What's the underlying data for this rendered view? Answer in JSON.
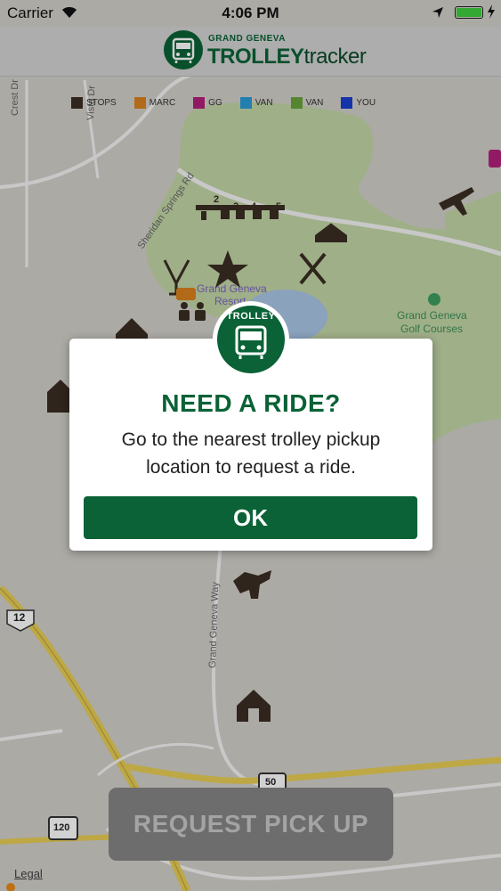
{
  "status_bar": {
    "carrier": "Carrier",
    "time": "4:06 PM"
  },
  "header": {
    "brand_top": "GRAND GENEVA",
    "brand_main_bold": "TROLLEY",
    "brand_main_light": "tracker"
  },
  "legend": [
    {
      "label": "STOPS",
      "color": "#3a2e24"
    },
    {
      "label": "MARC",
      "color": "#d9821f"
    },
    {
      "label": "GG",
      "color": "#b2207a"
    },
    {
      "label": "VAN",
      "color": "#2a9bd6"
    },
    {
      "label": "VAN",
      "color": "#6aa33a"
    },
    {
      "label": "YOU",
      "color": "#1a3fd0"
    }
  ],
  "map": {
    "roads": [
      "Crest Dr",
      "Sheridan Springs Rd",
      "Grand Geneva Way",
      "Vista Dr"
    ],
    "place_resort": "Grand Geneva Resort",
    "place_golf": "Grand Geneva Golf Courses",
    "route_shields": [
      "12",
      "50",
      "120"
    ],
    "ski_numbers": [
      "2",
      "3",
      "4",
      "5"
    ]
  },
  "modal": {
    "badge_label": "TROLLEY",
    "title": "NEED A RIDE?",
    "message": "Go to the nearest trolley pickup location to request a ride.",
    "ok_label": "OK"
  },
  "request_button": {
    "label": "REQUEST PICK UP"
  },
  "legal_label": "Legal",
  "colors": {
    "brand_green": "#0a6236",
    "map_green": "#c2d6a4",
    "road_yellow": "#e7cd55"
  }
}
